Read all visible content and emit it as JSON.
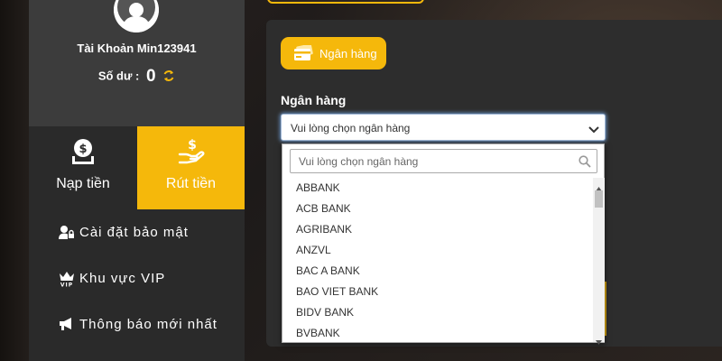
{
  "profile": {
    "username": "Tài Khoản Min123941",
    "balance_label": "Số dư :",
    "balance_value": "0"
  },
  "tabs": {
    "deposit": "Nạp tiền",
    "withdraw": "Rút tiền"
  },
  "menu": [
    {
      "label": "Cài đặt bảo mật",
      "icon": "user-lock-icon"
    },
    {
      "label": "Khu vực VIP",
      "icon": "vip-crown-icon"
    },
    {
      "label": "Thông báo mới nhất",
      "icon": "megaphone-icon"
    }
  ],
  "form": {
    "bank_tab_label": "Ngân hàng",
    "field_label": "Ngân hàng",
    "select_value": "Vui lòng chọn ngân hàng",
    "search_placeholder": "Vui lòng chọn ngân hàng"
  },
  "banks": [
    "ABBANK",
    "ACB BANK",
    "AGRIBANK",
    "ANZVL",
    "BAC A BANK",
    "BAO VIET BANK",
    "BIDV BANK",
    "BVBANK"
  ],
  "colors": {
    "accent": "#f5b80b",
    "sidebar_bg": "#2a2a2a",
    "panel_bg": "#2d2d2d"
  }
}
